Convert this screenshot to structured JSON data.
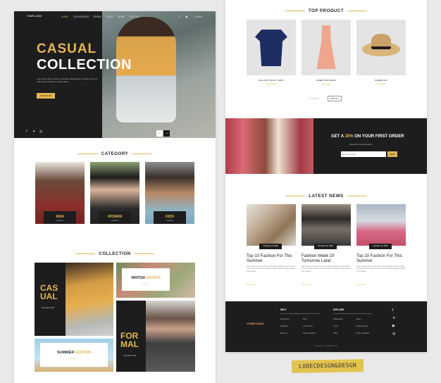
{
  "nav": {
    "logo": "YOUR LOGO",
    "items": [
      "HOME",
      "CATEGORIES",
      "TREND",
      "SHOP",
      "NEWS",
      "CONTACT"
    ],
    "login": "LOGIN"
  },
  "hero": {
    "title_line1": "CASUAL",
    "title_line2": "COLLECTION",
    "text": "Lorem ipsum dolor sit amet, consectetur adipiscing elit, sed diam nonummy nibh euismod tincidunt ut laoreet dolore.",
    "button": "SHOP NOW"
  },
  "category": {
    "title": "CATEGORY",
    "items": [
      {
        "name": "MAN",
        "sub": "collection"
      },
      {
        "name": "WOMAN",
        "sub": "collection"
      },
      {
        "name": "KIDS",
        "sub": "collection"
      }
    ]
  },
  "collection": {
    "title": "COLLECTION",
    "casual": "CAS UAL",
    "casual_sub": "COLLECTION",
    "winter_pre": "WINTER ",
    "winter_hl": "EDITION",
    "summer_pre": "SUMMER ",
    "summer_hl": "EDITION",
    "formal": "FOR MAL",
    "formal_sub": "COLLECTION"
  },
  "top_product": {
    "title": "TOP PRODUCT",
    "items": [
      {
        "name": "BLUE NAVY BASIC T-SHIRT",
        "price": "$ 19.90"
      },
      {
        "name": "SWEET PINK DRESS",
        "price": "$ 19.90"
      },
      {
        "name": "SUMMER HAT",
        "price": "$ 19.90"
      }
    ],
    "pages": [
      "1",
      "2",
      "3",
      "4"
    ],
    "view_all": "VIEW ALL"
  },
  "promo": {
    "pre": "GET A ",
    "highlight": "20%",
    "post": " ON YOUR FIRST ORDER",
    "sub": "Subscribe Your Newsletter",
    "placeholder": "Enter your email",
    "button": "SEND"
  },
  "news": {
    "title": "LATEST NEWS",
    "items": [
      {
        "date": "February 15, 2020",
        "title": "Top 10 Fashion For This Summer",
        "text": "Lorem ipsum dolor sit amet, consectetur adipiscing elit, sed diam nonummy nibh euismod tincidunt ut laoreet dolore magna aliquam erat volutpat.",
        "more": "Read more"
      },
      {
        "date": "February 15, 2020",
        "title": "Fashion Week Of Tomorrow Land",
        "text": "Lorem ipsum dolor sit amet, consectetur adipiscing elit, sed diam nonummy nibh euismod tincidunt ut laoreet dolore magna aliquam erat volutpat.",
        "more": "Read more"
      },
      {
        "date": "February 15, 2020",
        "title": "Top 10 Fashion For This Summer",
        "text": "Lorem ipsum dolor sit amet, consectetur adipiscing elit, sed diam nonummy nibh euismod tincidunt ut laoreet dolore magna aliquam erat volutpat.",
        "more": "Read more"
      }
    ]
  },
  "footer": {
    "logo": "YOUR LOGO",
    "help_title": "HELP",
    "help": [
      "Payments",
      "Shipping",
      "Returns"
    ],
    "help2": [
      "FAQ",
      "Contact Us",
      "Store Location"
    ],
    "explore_title": "EXPLORE",
    "explore": [
      "Categories",
      "Trend",
      "Shop"
    ],
    "explore2": [
      "News",
      "Privacy Policy",
      "Terms & Rights"
    ],
    "copyright": "Copyright · Your Website 2020"
  },
  "stamp_text": "LUDECDESGN&DESGN"
}
